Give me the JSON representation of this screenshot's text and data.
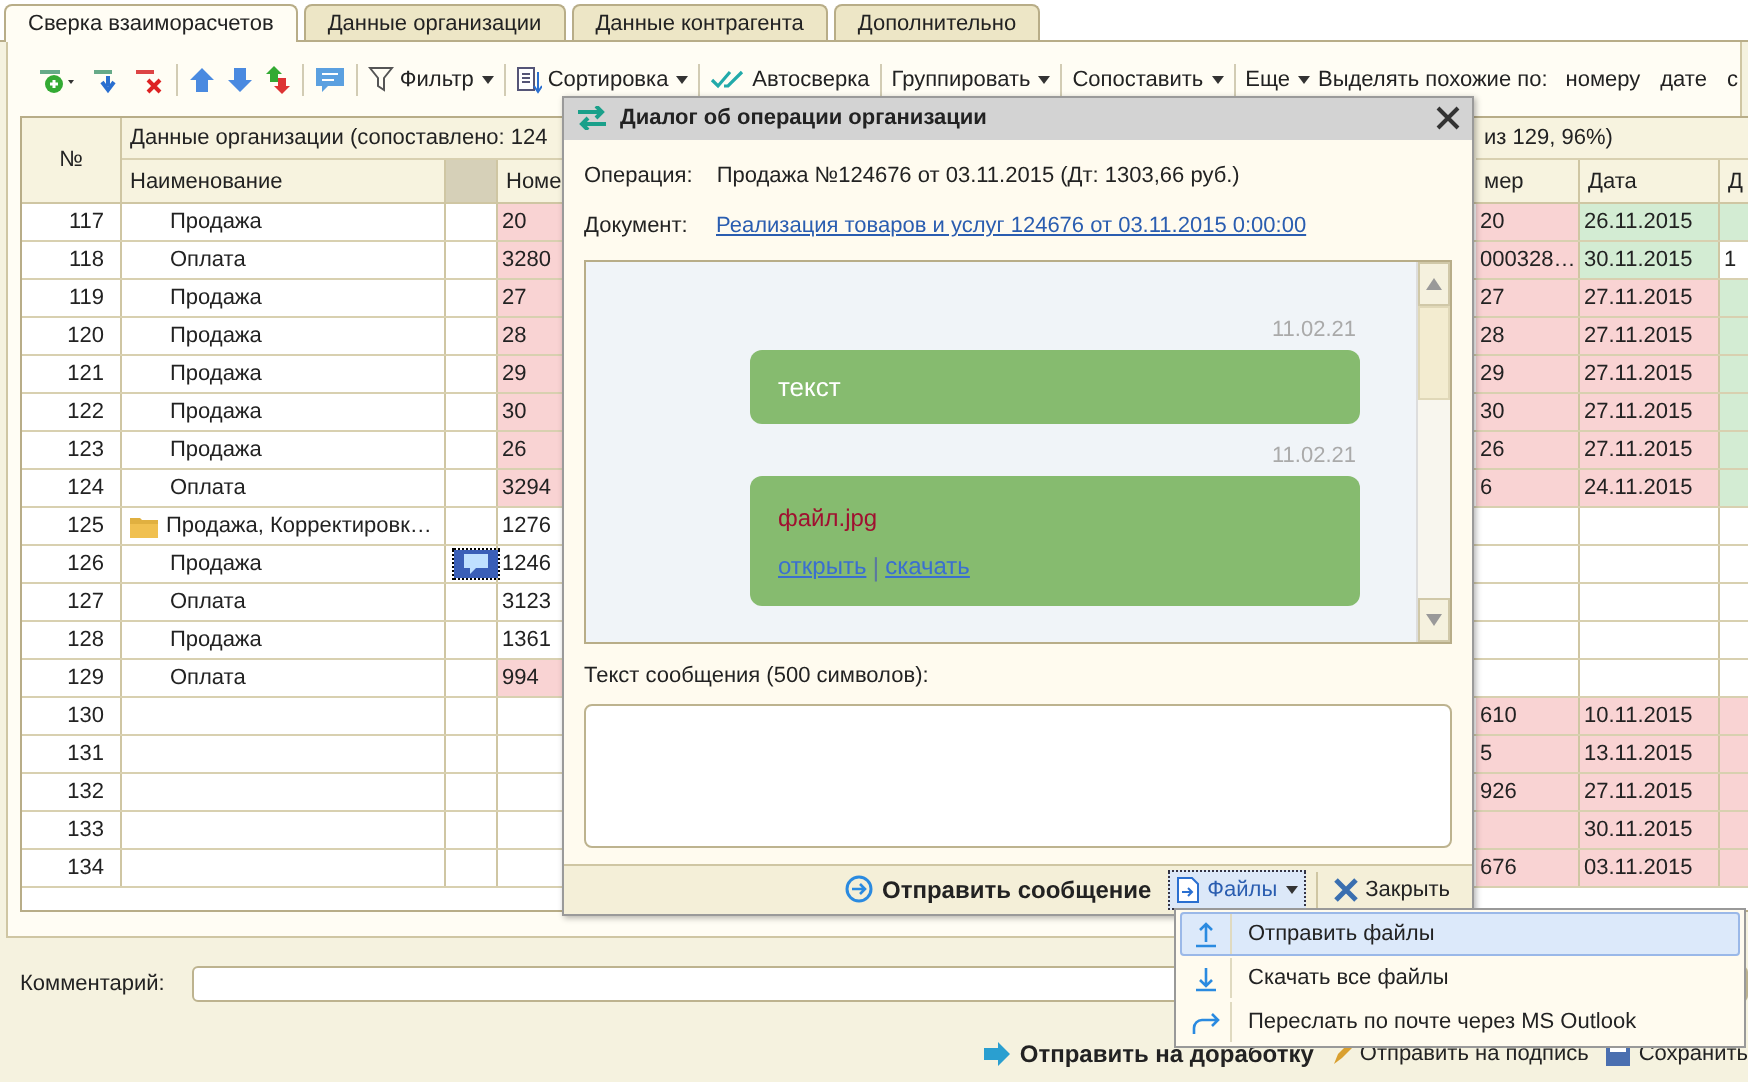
{
  "tabs": [
    {
      "label": "Сверка взаиморасчетов",
      "selected": true
    },
    {
      "label": "Данные организации",
      "selected": false
    },
    {
      "label": "Данные контрагента",
      "selected": false
    },
    {
      "label": "Дополнительно",
      "selected": false
    }
  ],
  "toolbar": [
    {
      "kind": "menu",
      "label": "Фильтр"
    },
    {
      "kind": "menu",
      "label": "Сортировка"
    },
    {
      "kind": "button",
      "label": "Автосверка"
    },
    {
      "kind": "menu",
      "label": "Группировать"
    },
    {
      "kind": "menu",
      "label": "Сопоставить"
    },
    {
      "kind": "menu",
      "label": "Еще"
    },
    {
      "kind": "label",
      "label": "Выделять похожие по:"
    },
    {
      "kind": "option",
      "label": "номеру"
    },
    {
      "kind": "option",
      "label": "дате"
    },
    {
      "kind": "option",
      "label": "с"
    }
  ],
  "table": {
    "number_header": "№",
    "group_header_left": "Данные организации (сопоставлено: 124",
    "group_header_right": "из 129, 96%)",
    "columns_left": [
      "Наименование",
      "Номе"
    ],
    "columns_right": [
      "мер",
      "Дата",
      "Д"
    ],
    "rows": [
      {
        "no": "117",
        "name": "Продажа",
        "cells": [
          {
            "text": "20",
            "color": "#f9d3d3"
          },
          {
            "text": "20",
            "color": "#f9d3d3"
          },
          {
            "text": "26.11.2015",
            "color": "#d3ecd3"
          },
          {
            "color": "#d3ecd3"
          }
        ]
      },
      {
        "no": "118",
        "name": "Оплата",
        "cells": [
          {
            "text": "3280",
            "color": "#f9d3d3"
          },
          {
            "text": "000328…",
            "color": "#f9d3d3"
          },
          {
            "text": "30.11.2015",
            "color": "#d3ecd3"
          },
          {
            "text": "1"
          }
        ]
      },
      {
        "no": "119",
        "name": "Продажа",
        "cells": [
          {
            "text": "27",
            "color": "#f9d3d3"
          },
          {
            "text": "27",
            "color": "#f9d3d3"
          },
          {
            "text": "27.11.2015",
            "color": "#f9d3d3"
          },
          {
            "color": "#d3ecd3"
          }
        ]
      },
      {
        "no": "120",
        "name": "Продажа",
        "cells": [
          {
            "text": "28",
            "color": "#f9d3d3"
          },
          {
            "text": "28",
            "color": "#f9d3d3"
          },
          {
            "text": "27.11.2015",
            "color": "#f9d3d3"
          },
          {
            "color": "#d3ecd3"
          }
        ]
      },
      {
        "no": "121",
        "name": "Продажа",
        "cells": [
          {
            "text": "29",
            "color": "#f9d3d3"
          },
          {
            "text": "29",
            "color": "#f9d3d3"
          },
          {
            "text": "27.11.2015",
            "color": "#f9d3d3"
          },
          {
            "color": "#d3ecd3"
          }
        ]
      },
      {
        "no": "122",
        "name": "Продажа",
        "cells": [
          {
            "text": "30",
            "color": "#f9d3d3"
          },
          {
            "text": "30",
            "color": "#f9d3d3"
          },
          {
            "text": "27.11.2015",
            "color": "#f9d3d3"
          },
          {
            "color": "#d3ecd3"
          }
        ]
      },
      {
        "no": "123",
        "name": "Продажа",
        "cells": [
          {
            "text": "26",
            "color": "#f9d3d3"
          },
          {
            "text": "26",
            "color": "#f9d3d3"
          },
          {
            "text": "27.11.2015",
            "color": "#f9d3d3"
          },
          {
            "color": "#d3ecd3"
          }
        ]
      },
      {
        "no": "124",
        "name": "Оплата",
        "cells": [
          {
            "text": "3294",
            "color": "#f9d3d3"
          },
          {
            "text": "6",
            "color": "#f9d3d3"
          },
          {
            "text": "24.11.2015",
            "color": "#f9d3d3"
          },
          {
            "color": "#d3ecd3"
          }
        ]
      },
      {
        "no": "125",
        "kind": "group",
        "name": "Продажа, Корректировк…",
        "cells": [
          {
            "text": "1276"
          },
          {},
          {},
          {}
        ]
      },
      {
        "no": "126",
        "name": "Продажа",
        "has_comment": true,
        "cells": [
          {
            "text": "1246"
          },
          {},
          {},
          {}
        ]
      },
      {
        "no": "127",
        "name": "Оплата",
        "cells": [
          {
            "text": "3123"
          },
          {},
          {},
          {}
        ]
      },
      {
        "no": "128",
        "name": "Продажа",
        "cells": [
          {
            "text": "1361"
          },
          {},
          {},
          {}
        ]
      },
      {
        "no": "129",
        "name": "Оплата",
        "cells": [
          {
            "text": "994",
            "color": "#f9d3d3"
          },
          {},
          {},
          {}
        ]
      },
      {
        "no": "130",
        "cells": [
          {},
          {
            "text": "610",
            "color": "#f9d3d3"
          },
          {
            "text": "10.11.2015",
            "color": "#f9d3d3"
          },
          {
            "color": "#f9d3d3"
          }
        ]
      },
      {
        "no": "131",
        "cells": [
          {},
          {
            "text": "5",
            "color": "#f9d3d3"
          },
          {
            "text": "13.11.2015",
            "color": "#f9d3d3"
          },
          {
            "color": "#f9d3d3"
          }
        ]
      },
      {
        "no": "132",
        "cells": [
          {},
          {
            "text": "926",
            "color": "#f9d3d3"
          },
          {
            "text": "27.11.2015",
            "color": "#f9d3d3"
          },
          {
            "color": "#f9d3d3"
          }
        ]
      },
      {
        "no": "133",
        "cells": [
          {},
          {
            "color": "#f9d3d3"
          },
          {
            "text": "30.11.2015",
            "color": "#f9d3d3"
          },
          {
            "color": "#f9d3d3"
          }
        ]
      },
      {
        "no": "134",
        "cells": [
          {},
          {
            "text": "676",
            "color": "#f9d3d3"
          },
          {
            "text": "03.11.2015",
            "color": "#f9d3d3"
          },
          {
            "color": "#f9d3d3"
          }
        ]
      }
    ]
  },
  "comment": {
    "label": "Комментарий:"
  },
  "bottom_buttons": [
    {
      "label": "Отправить на доработку",
      "kind": "primary"
    },
    {
      "label": "Отправить на подпись",
      "kind": "sign"
    },
    {
      "label": "Сохранить",
      "kind": "save"
    }
  ],
  "dialog": {
    "title": "Диалог об операции организации",
    "operation_label": "Операция:",
    "operation": "Продажа №124676 от 03.11.2015 (Дт: 1303,66 руб.)",
    "document_label": "Документ:",
    "document_link": "Реализация товаров и услуг 124676 от 03.11.2015 0:00:00",
    "messages": [
      {
        "kind": "text",
        "date": "11.02.21",
        "text": "текст"
      },
      {
        "kind": "file",
        "date": "11.02.21",
        "file_name": "файл.jpg",
        "open_link": "открыть",
        "separator": "|",
        "download_link": "скачать"
      }
    ],
    "message_label": "Текст сообщения (500 символов):",
    "send_button": "Отправить сообщение",
    "files_button": "Файлы",
    "close_button": "Закрыть"
  },
  "files_menu": [
    {
      "label": "Отправить файлы",
      "selected": true
    },
    {
      "label": "Скачать все файлы",
      "selected": false
    },
    {
      "label": "Переслать по почте через MS Outlook",
      "selected": false
    }
  ]
}
